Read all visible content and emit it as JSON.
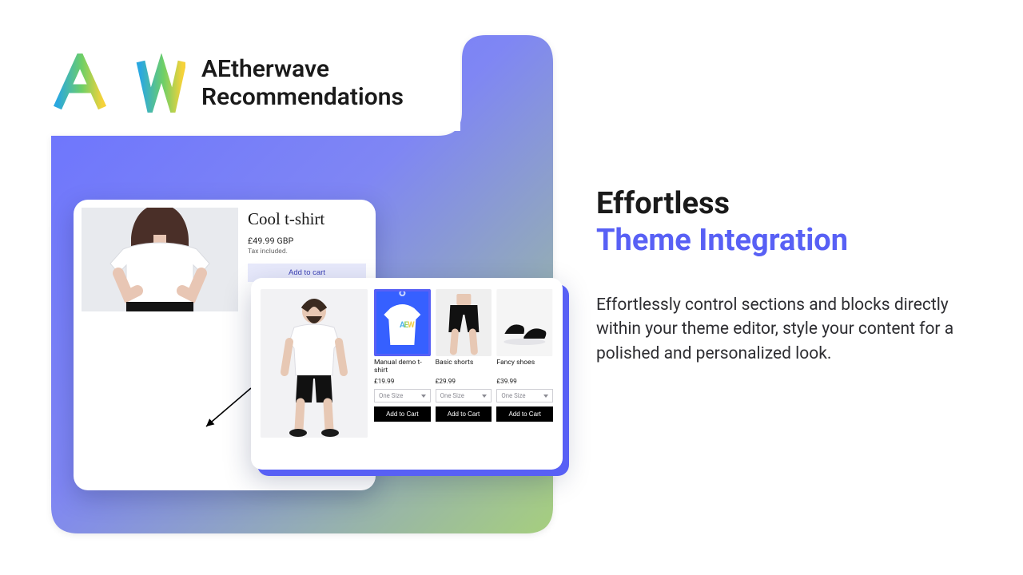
{
  "brand": {
    "line1": "AEtherwave",
    "line2": "Recommendations"
  },
  "product": {
    "title": "Cool t-shirt",
    "price": "£49.99 GBP",
    "tax": "Tax included.",
    "add": "Add to cart"
  },
  "recs": {
    "size_label": "One Size",
    "add_label": "Add to Cart",
    "items": [
      {
        "name": "Manual demo t-shirt",
        "price": "£19.99"
      },
      {
        "name": "Basic shorts",
        "price": "£29.99"
      },
      {
        "name": "Fancy shoes",
        "price": "£39.99"
      }
    ]
  },
  "headline": {
    "a": "Effortless",
    "b": "Theme Integration"
  },
  "body": "Effortlessly control sections and blocks directly within your theme editor, style your content for a polished and personalized look."
}
